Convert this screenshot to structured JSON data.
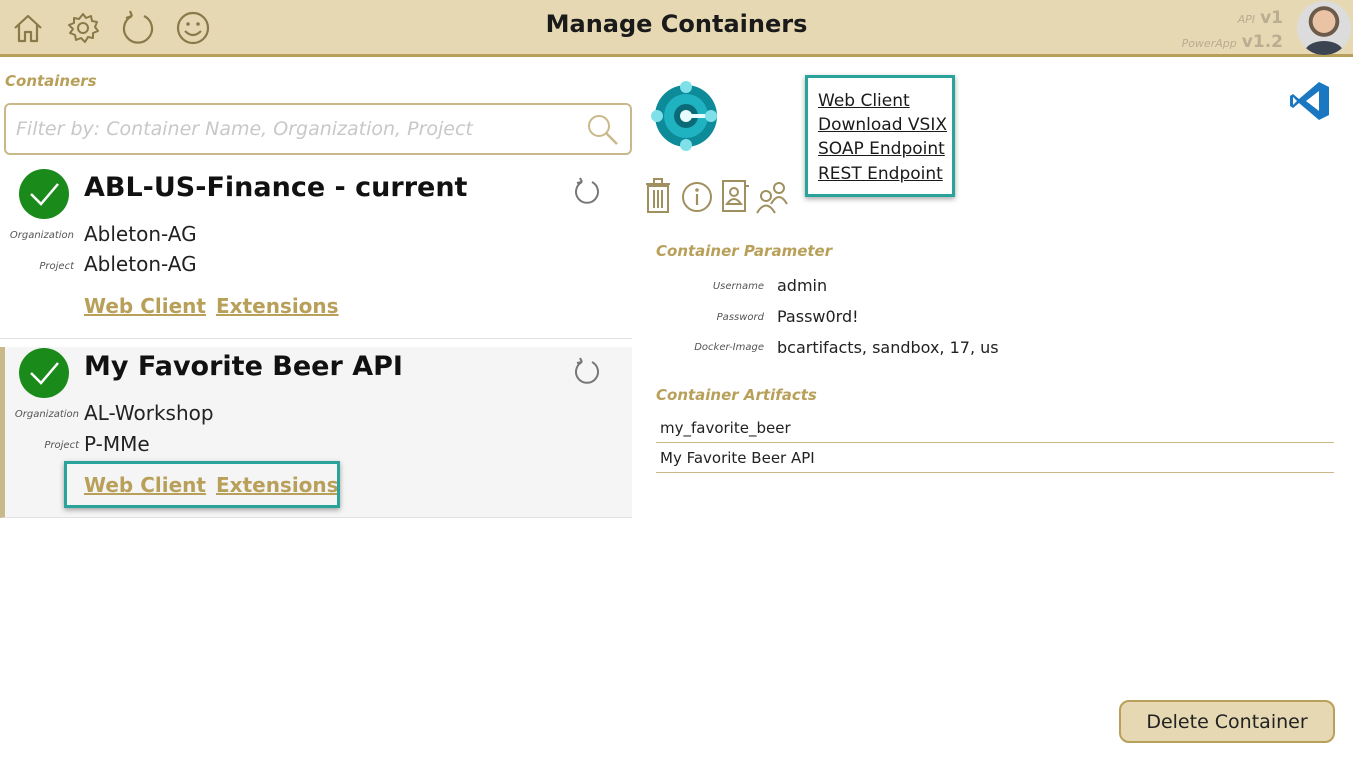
{
  "header": {
    "title": "Manage Containers",
    "api_label": "API",
    "api_version": "v1",
    "powerapp_label": "PowerApp",
    "powerapp_version": "v1.2"
  },
  "containers_section": {
    "label": "Containers",
    "filter_placeholder": "Filter by: Container Name, Organization, Project"
  },
  "container_list": [
    {
      "name": "ABL-US-Finance - current",
      "organization_label": "Organization",
      "organization": "Ableton-AG",
      "project_label": "Project",
      "project": "Ableton-AG",
      "web_client_label": "Web Client",
      "extensions_label": "Extensions"
    },
    {
      "name": "My Favorite Beer API",
      "organization_label": "Organization",
      "organization": "AL-Workshop",
      "project_label": "Project",
      "project": "P-MMe",
      "web_client_label": "Web Client",
      "extensions_label": "Extensions"
    }
  ],
  "detail": {
    "links": [
      "Web Client",
      "Download VSIX",
      "SOAP Endpoint",
      "REST Endpoint"
    ],
    "parameter_section": "Container Parameter",
    "parameters": [
      {
        "label": "Username",
        "value": "admin"
      },
      {
        "label": "Password",
        "value": "Passw0rd!"
      },
      {
        "label": "Docker-Image",
        "value": "bcartifacts, sandbox, 17, us"
      }
    ],
    "artifacts_section": "Container Artifacts",
    "artifacts": [
      "my_favorite_beer",
      "My Favorite Beer API"
    ],
    "delete_label": "Delete Container"
  },
  "colors": {
    "header_bg": "#e6d8b3",
    "accent_gold": "#b8a05a",
    "highlight_teal": "#2aa39a",
    "status_green": "#1a8a1a"
  },
  "icons": {
    "header": [
      "home-icon",
      "gear-icon",
      "refresh-icon",
      "smiley-icon"
    ],
    "actions": [
      "trash-icon",
      "info-icon",
      "contact-book-icon",
      "users-icon"
    ]
  }
}
